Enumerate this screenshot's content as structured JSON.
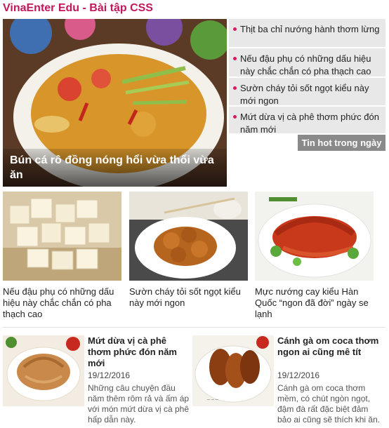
{
  "site_title": "VinaEnter Edu - Bài tập CSS",
  "hero": {
    "caption": "Bún cá rô đồng nóng hổi vừa thổi vừa ăn"
  },
  "hot_list": {
    "items": [
      "Thịt ba chỉ nướng hành thơm lừng",
      "Nếu đậu phụ có những dấu hiệu này chắc chắn có pha thạch cao",
      "Sườn cháy tỏi sốt ngọt kiểu này mới ngon",
      "Mứt dừa vị cà phê thơm phức đón năm mới"
    ],
    "footer_label": "Tin hot trong ngày"
  },
  "grid": [
    {
      "title": "Nếu đậu phụ có những dấu hiệu này chắc chắn có pha thạch cao"
    },
    {
      "title": "Sườn cháy tỏi sốt ngọt kiểu này mới ngon"
    },
    {
      "title": "Mực nướng cay kiểu Hàn Quốc “ngon đã đời” ngày se lạnh"
    }
  ],
  "news": [
    {
      "title": "Mứt dừa vị cà phê thơm phức đón năm mới",
      "date": "19/12/2016",
      "desc": "Những câu chuyện đầu năm thêm rôm rả và ấm áp với món mứt dừa vị cà phê hấp dẫn này."
    },
    {
      "title": "Cánh gà om coca thơm ngon ai cũng mê tít",
      "date": "19/12/2016",
      "desc": "Cánh gà om coca thơm mềm, có chút ngòn ngọt, đậm đà rất đặc biệt đảm bảo ai cũng sẽ thích khi ăn."
    }
  ]
}
